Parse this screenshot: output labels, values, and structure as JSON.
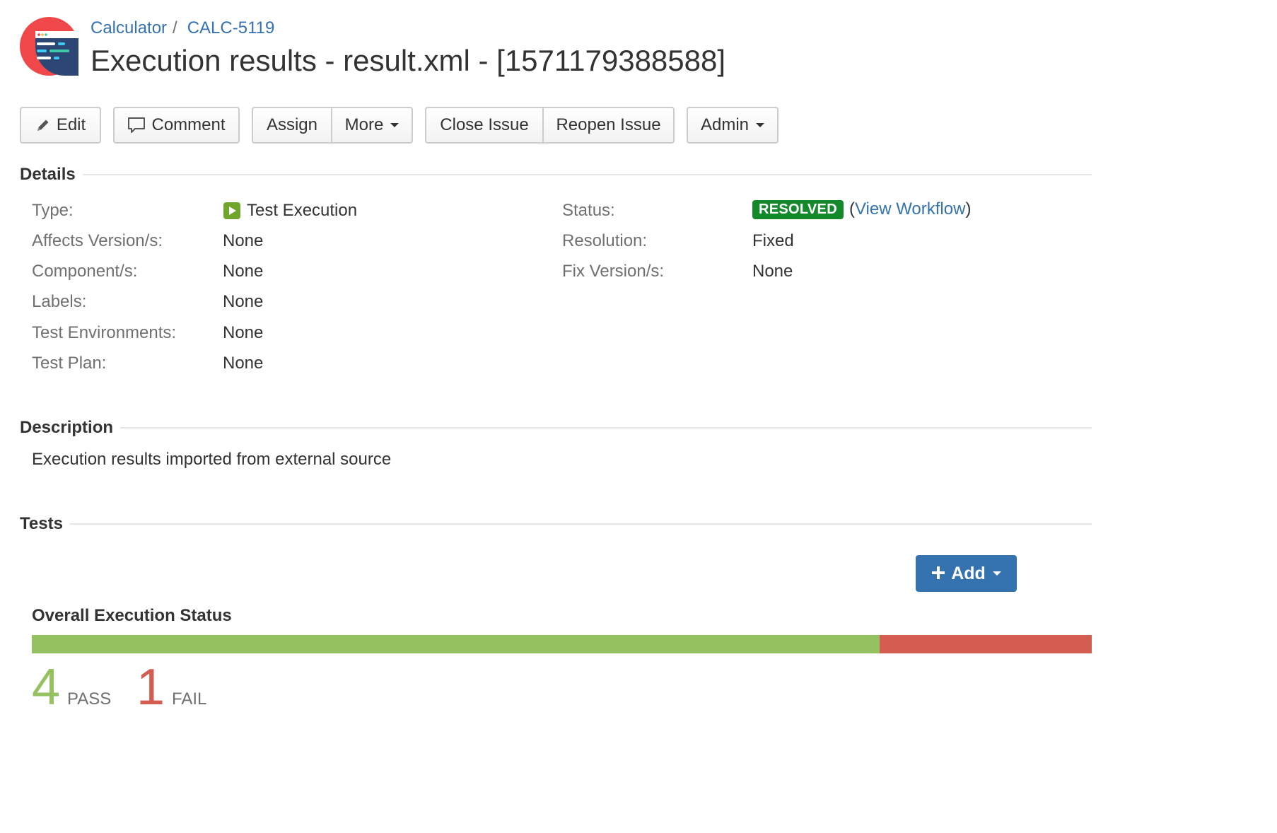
{
  "breadcrumb": {
    "project": "Calculator",
    "separator": "/",
    "issue_key": "CALC-5119"
  },
  "page_title": "Execution results - result.xml - [1571179388588]",
  "toolbar": {
    "edit_label": "Edit",
    "comment_label": "Comment",
    "assign_label": "Assign",
    "more_label": "More",
    "close_issue_label": "Close Issue",
    "reopen_issue_label": "Reopen Issue",
    "admin_label": "Admin"
  },
  "details": {
    "heading": "Details",
    "left": [
      {
        "label": "Type:",
        "value": "Test Execution"
      },
      {
        "label": "Affects Version/s:",
        "value": "None"
      },
      {
        "label": "Component/s:",
        "value": "None"
      },
      {
        "label": "Labels:",
        "value": "None"
      },
      {
        "label": "Test Environments:",
        "value": "None"
      },
      {
        "label": "Test Plan:",
        "value": "None"
      }
    ],
    "right": [
      {
        "label": "Status:",
        "value": "RESOLVED"
      },
      {
        "label": "Resolution:",
        "value": "Fixed"
      },
      {
        "label": "Fix Version/s:",
        "value": "None"
      }
    ],
    "view_workflow_label": "View Workflow",
    "paren_open": "(",
    "paren_close": ")"
  },
  "description": {
    "heading": "Description",
    "text": "Execution results imported from external source"
  },
  "tests": {
    "heading": "Tests",
    "add_label": "Add",
    "overall_title": "Overall Execution Status",
    "pass_count": "4",
    "pass_label": "PASS",
    "fail_count": "1",
    "fail_label": "FAIL",
    "pass_fraction": 0.8,
    "fail_fraction": 0.2
  },
  "colors": {
    "link": "#3572b0",
    "resolved": "#14892c",
    "pass": "#95c160",
    "fail": "#d45d52",
    "primary_button": "#3572b0"
  }
}
